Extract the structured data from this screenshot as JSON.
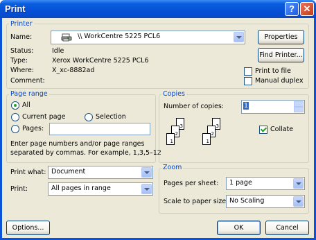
{
  "window": {
    "title": "Print",
    "help_glyph": "?",
    "close_glyph": "✕"
  },
  "printer": {
    "legend": "Printer",
    "name_label": "Name:",
    "name_value": "\\\\ WorkCentre 5225 PCL6",
    "properties": "Properties",
    "status_label": "Status:",
    "status_value": "Idle",
    "type_label": "Type:",
    "type_value": "Xerox WorkCentre 5225 PCL6",
    "where_label": "Where:",
    "where_value": "X_xc-8882ad",
    "comment_label": "Comment:",
    "find_printer": "Find Printer...",
    "print_to_file": "Print to file",
    "manual_duplex": "Manual duplex"
  },
  "page_range": {
    "legend": "Page range",
    "all": "All",
    "current_page": "Current page",
    "selection": "Selection",
    "pages": "Pages:",
    "pages_value": "",
    "hint_line1": "Enter page numbers and/or page ranges",
    "hint_line2": "separated by commas.  For example, 1,3,5–12"
  },
  "copies": {
    "legend": "Copies",
    "number_label": "Number of copies:",
    "number_value": "1",
    "collate": "Collate",
    "stack_numbers": [
      "3",
      "2",
      "1"
    ]
  },
  "print_what": {
    "label": "Print what:",
    "value": "Document"
  },
  "print": {
    "label": "Print:",
    "value": "All pages in range"
  },
  "zoom": {
    "legend": "Zoom",
    "pages_per_sheet_label": "Pages per sheet:",
    "pages_per_sheet_value": "1 page",
    "scale_label": "Scale to paper size:",
    "scale_value": "No Scaling"
  },
  "buttons": {
    "options": "Options...",
    "ok": "OK",
    "cancel": "Cancel"
  },
  "colors": {
    "titlebar": "#0550d6",
    "dialog": "#ece9d8",
    "group_title": "#0046d5",
    "check": "#21a121"
  }
}
